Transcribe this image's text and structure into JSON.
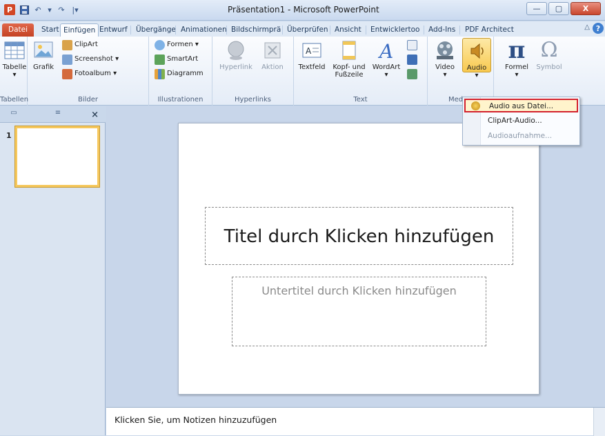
{
  "window": {
    "title": "Präsentation1 - Microsoft PowerPoint",
    "minimize": "—",
    "maximize": "▢",
    "close": "X"
  },
  "qat": {
    "logo": "P",
    "undo": "↶",
    "dropdown": "▾",
    "redo": "↷",
    "customize": "|▾"
  },
  "tabs": [
    {
      "label": "Datei"
    },
    {
      "label": "Start"
    },
    {
      "label": "Einfügen"
    },
    {
      "label": "Entwurf"
    },
    {
      "label": "Übergänge"
    },
    {
      "label": "Animationen"
    },
    {
      "label": "Bildschirmprä"
    },
    {
      "label": "Überprüfen"
    },
    {
      "label": "Ansicht"
    },
    {
      "label": "Entwicklertoo"
    },
    {
      "label": "Add-Ins"
    },
    {
      "label": "PDF Architect"
    }
  ],
  "help": "?",
  "collapse_ribbon": "△",
  "ribbon": {
    "groups": {
      "tabellen": "Tabellen",
      "bilder": "Bilder",
      "illustrationen": "Illustrationen",
      "hyperlinks": "Hyperlinks",
      "text": "Text",
      "medien": "Med"
    },
    "tabelle": "Tabelle",
    "grafik": "Grafik",
    "clipart": "ClipArt",
    "screenshot": "Screenshot ▾",
    "fotoalbum": "Fotoalbum ▾",
    "formen": "Formen ▾",
    "smartart": "SmartArt",
    "diagramm": "Diagramm",
    "hyperlink": "Hyperlink",
    "aktion": "Aktion",
    "textfeld": "Textfeld",
    "kopf_fusszeile": "Kopf- und Fußzeile",
    "wordart": "WordArt",
    "video": "Video",
    "audio": "Audio",
    "formel": "Formel",
    "symbol": "Symbol",
    "dropdown_arrow": "▾"
  },
  "audio_menu": {
    "items": [
      "Audio aus Datei...",
      "ClipArt-Audio...",
      "Audioaufnahme..."
    ]
  },
  "pane": {
    "tab_icon_1": "▭",
    "tab_icon_2": "≡",
    "close": "×",
    "slide_number": "1"
  },
  "slide": {
    "title_placeholder": "Titel durch Klicken hinzufügen",
    "subtitle_placeholder": "Untertitel durch Klicken hinzufügen"
  },
  "notes": {
    "placeholder": "Klicken Sie, um Notizen hinzuzufügen"
  }
}
